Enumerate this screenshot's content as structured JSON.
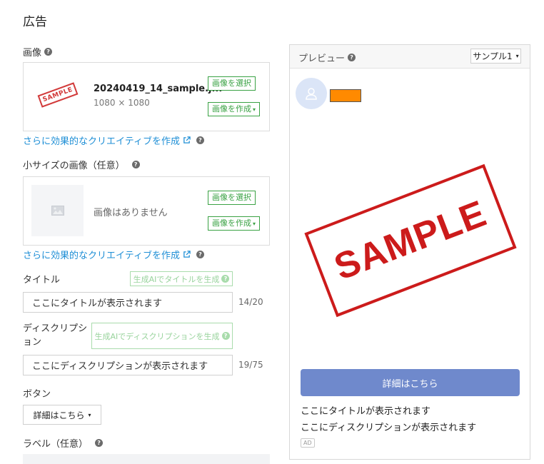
{
  "page_title": "広告",
  "image_section": {
    "label": "画像",
    "filename": "20240419_14_sample.j...",
    "dimensions": "1080 × 1080",
    "thumb_text": "SAMPLE",
    "select_button": "画像を選択",
    "create_button": "画像を作成",
    "creative_link": "さらに効果的なクリエイティブを作成"
  },
  "small_image_section": {
    "label": "小サイズの画像（任意）",
    "empty_text": "画像はありません",
    "select_button": "画像を選択",
    "create_button": "画像を作成",
    "creative_link": "さらに効果的なクリエイティブを作成"
  },
  "title_section": {
    "label": "タイトル",
    "ai_button": "生成AIでタイトルを生成",
    "value": "ここにタイトルが表示されます",
    "count": "14/20"
  },
  "description_section": {
    "label_line1": "ディスクリプシ",
    "label_line2": "ョン",
    "ai_button": "生成AIでディスクリプションを生成",
    "value": "ここにディスクリプションが表示されます",
    "count": "19/75"
  },
  "button_section": {
    "label": "ボタン",
    "selected": "詳細はこちら"
  },
  "label_section": {
    "label": "ラベル（任意）"
  },
  "preview": {
    "label": "プレビュー",
    "sample_select": "サンプル1",
    "image_text": "SAMPLE",
    "cta": "詳細はこちら",
    "title": "ここにタイトルが表示されます",
    "description": "ここにディスクリプションが表示されます",
    "ad_badge": "AD"
  },
  "colors": {
    "accent_green": "#3aa244",
    "link_blue": "#1f8fd6",
    "cta_blue": "#6f89cc",
    "stamp_red": "#cc1b1b",
    "advertiser_orange": "#ff8a00"
  }
}
